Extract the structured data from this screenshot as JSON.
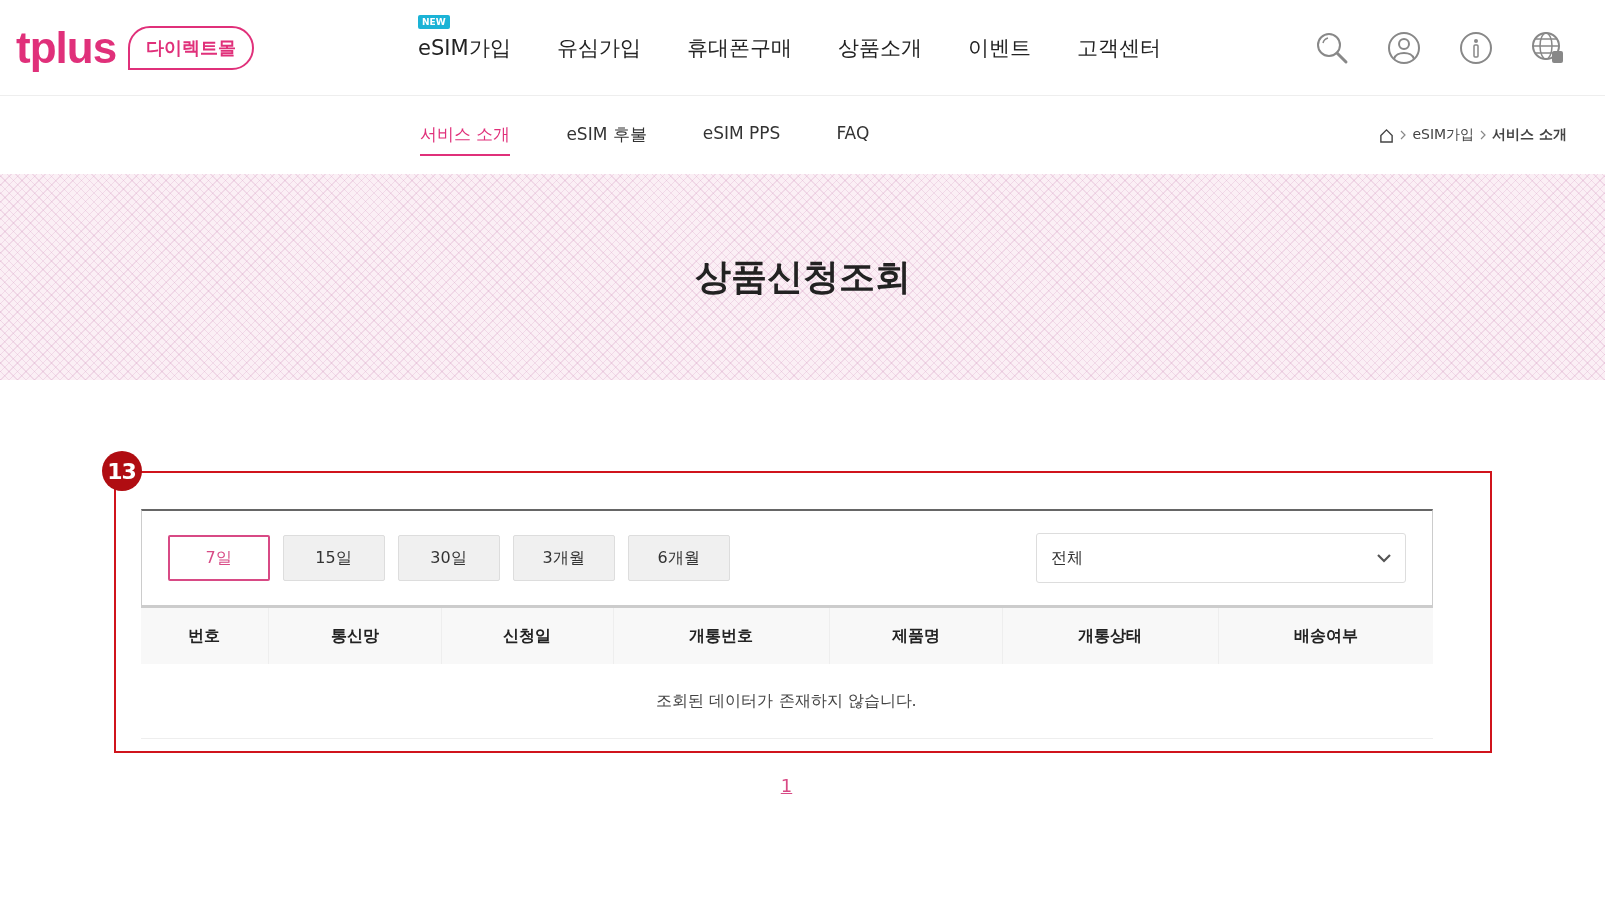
{
  "header": {
    "logo": "tplus",
    "logo_tag": "다이렉트몰",
    "nav": [
      {
        "label": "eSIM가입",
        "badge": "NEW"
      },
      {
        "label": "유심가입"
      },
      {
        "label": "휴대폰구매"
      },
      {
        "label": "상품소개"
      },
      {
        "label": "이벤트"
      },
      {
        "label": "고객센터"
      }
    ]
  },
  "subnav": [
    {
      "label": "서비스 소개",
      "selected": true
    },
    {
      "label": "eSIM 후불",
      "selected": false
    },
    {
      "label": "eSIM PPS",
      "selected": false
    },
    {
      "label": "FAQ",
      "selected": false
    }
  ],
  "breadcrumb": [
    "eSIM가입",
    "서비스 소개"
  ],
  "page_title": "상품신청조회",
  "callout_number": "13",
  "periods": [
    {
      "label": "7일",
      "selected": true
    },
    {
      "label": "15일",
      "selected": false
    },
    {
      "label": "30일",
      "selected": false
    },
    {
      "label": "3개월",
      "selected": false
    },
    {
      "label": "6개월",
      "selected": false
    }
  ],
  "filter": {
    "value": "전체"
  },
  "table": {
    "columns": [
      "번호",
      "통신망",
      "신청일",
      "개통번호",
      "제품명",
      "개통상태",
      "배송여부"
    ],
    "empty_message": "조회된 데이터가 존재하지 않습니다."
  },
  "pagination": [
    {
      "label": "1",
      "selected": true
    }
  ]
}
